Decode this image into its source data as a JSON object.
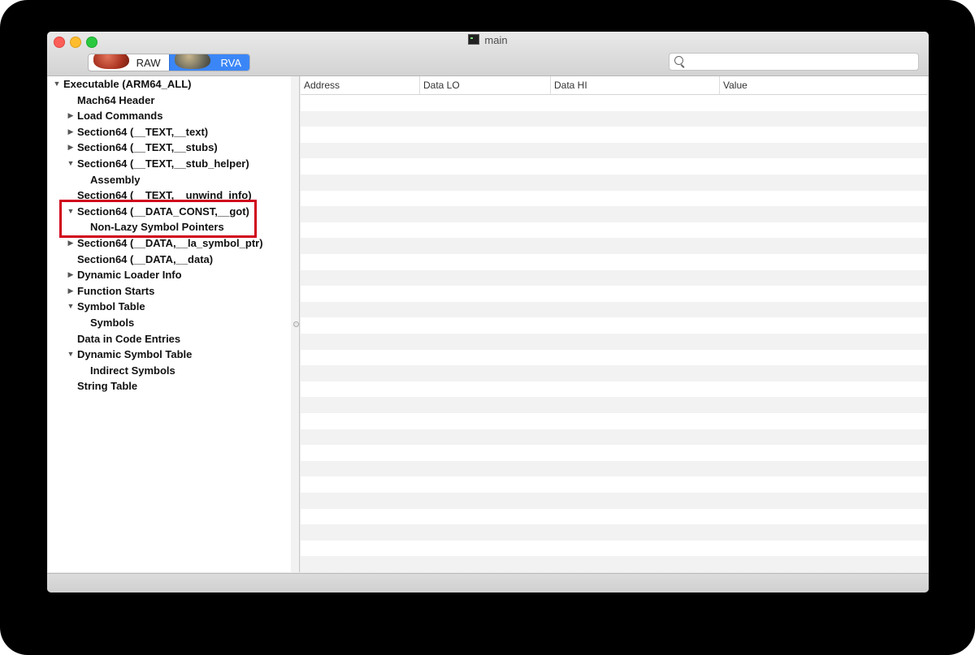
{
  "window": {
    "title": "main"
  },
  "toolbar": {
    "raw_label": "RAW",
    "rva_label": "RVA",
    "active_mode": "RVA",
    "search_value": "",
    "search_placeholder": ""
  },
  "tree": [
    {
      "label": "Executable  (ARM64_ALL)",
      "indent": 0,
      "disclosure": "expanded"
    },
    {
      "label": "Mach64 Header",
      "indent": 1,
      "disclosure": "none"
    },
    {
      "label": "Load Commands",
      "indent": 1,
      "disclosure": "collapsed"
    },
    {
      "label": "Section64 (__TEXT,__text)",
      "indent": 1,
      "disclosure": "collapsed"
    },
    {
      "label": "Section64 (__TEXT,__stubs)",
      "indent": 1,
      "disclosure": "collapsed"
    },
    {
      "label": "Section64 (__TEXT,__stub_helper)",
      "indent": 1,
      "disclosure": "expanded"
    },
    {
      "label": "Assembly",
      "indent": 2,
      "disclosure": "none"
    },
    {
      "label": "Section64 (__TEXT,__unwind_info)",
      "indent": 1,
      "disclosure": "none"
    },
    {
      "label": "Section64 (__DATA_CONST,__got)",
      "indent": 1,
      "disclosure": "expanded"
    },
    {
      "label": "Non-Lazy Symbol Pointers",
      "indent": 2,
      "disclosure": "none"
    },
    {
      "label": "Section64 (__DATA,__la_symbol_ptr)",
      "indent": 1,
      "disclosure": "collapsed"
    },
    {
      "label": "Section64 (__DATA,__data)",
      "indent": 1,
      "disclosure": "none"
    },
    {
      "label": "Dynamic Loader Info",
      "indent": 1,
      "disclosure": "collapsed"
    },
    {
      "label": "Function Starts",
      "indent": 1,
      "disclosure": "collapsed"
    },
    {
      "label": "Symbol Table",
      "indent": 1,
      "disclosure": "expanded"
    },
    {
      "label": "Symbols",
      "indent": 2,
      "disclosure": "none"
    },
    {
      "label": "Data in Code Entries",
      "indent": 1,
      "disclosure": "none"
    },
    {
      "label": "Dynamic Symbol Table",
      "indent": 1,
      "disclosure": "expanded"
    },
    {
      "label": "Indirect Symbols",
      "indent": 2,
      "disclosure": "none"
    },
    {
      "label": "String Table",
      "indent": 1,
      "disclosure": "none"
    }
  ],
  "highlighted_items": [
    "Section64 (__DATA_CONST,__got)",
    "Non-Lazy Symbol Pointers"
  ],
  "highlight_color": "#d0021b",
  "table": {
    "columns": [
      "Address",
      "Data LO",
      "Data HI",
      "Value"
    ],
    "rows": []
  },
  "colors": {
    "accent": "#3b86f7",
    "traffic_close": "#fc5f57",
    "traffic_minimize": "#fdbd2e",
    "traffic_zoom": "#2ac940"
  }
}
